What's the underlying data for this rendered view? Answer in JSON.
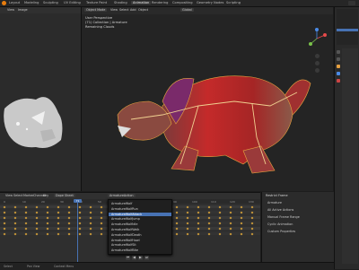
{
  "menu": {
    "items": [
      "Layout",
      "Modeling",
      "Sculpting",
      "UV Editing",
      "Texture Paint",
      "Shading",
      "Animation",
      "Rendering",
      "Compositing",
      "Geometry Nodes",
      "Scripting"
    ],
    "active_index": 6
  },
  "viewport": {
    "header_mode": "Object Mode",
    "view_menu": [
      "View",
      "Select",
      "Add",
      "Object"
    ],
    "transform": "Global",
    "info": {
      "line1": "User Perspective",
      "line2": "(71) Collection | Armature",
      "line3": "Remaining Clouds"
    }
  },
  "left_editor": {
    "header": [
      "View",
      "Image"
    ]
  },
  "dopesheet": {
    "header": [
      "View",
      "Select",
      "Marker",
      "Channel",
      "Key"
    ],
    "mode": "Dope Sheet",
    "action_field": "ArmatureAction",
    "frame_numbers": [
      "0",
      "10",
      "20",
      "30",
      "40",
      "50",
      "60",
      "70",
      "80",
      "90",
      "100",
      "110",
      "120",
      "130"
    ],
    "current_frame": "71"
  },
  "action_list": {
    "items": [
      "ArmatureWolf",
      "ArmatureWolfRun",
      "ArmatureWolfAttack",
      "ArmatureWolfJump",
      "ArmatureWolfIdle",
      "ArmatureWolfWalk",
      "ArmatureWolfDeath",
      "ArmatureWolfHowl",
      "ArmatureWolfSit",
      "ArmatureWolfBite"
    ],
    "selected_index": 2
  },
  "props_panel": {
    "title": "Restrict Frame",
    "rows": [
      "Armature",
      "All Active Actions",
      "Manual Frame Range",
      "Cyclic Animation",
      "Custom Properties"
    ]
  },
  "statusbar": {
    "left": "Select",
    "mid": "Pan View",
    "right": "Context Menu"
  },
  "colors": {
    "accent": "#4772b3",
    "keyframe": "#d6a23a",
    "wolf_red": "#c42a2a",
    "bone_orange": "#e8a640"
  }
}
